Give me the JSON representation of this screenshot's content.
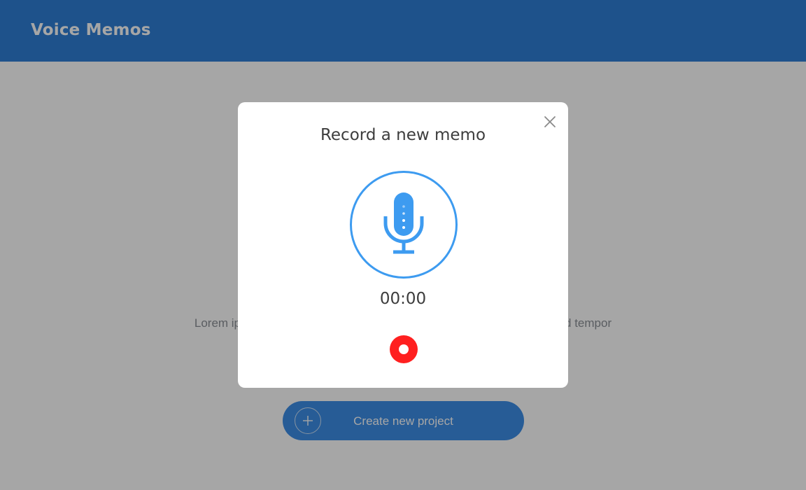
{
  "header": {
    "title": "Voice Memos"
  },
  "main": {
    "description": "Lorem ipsum dolor sit amet, consectetur adipiscing elit, sed do eiusmod tempor",
    "create_button_label": "Create new project",
    "create_button_icon": "plus-icon"
  },
  "modal": {
    "title": "Record a new memo",
    "timer": "00:00",
    "close_icon": "close-icon",
    "mic_icon": "microphone-icon",
    "record_icon": "record-icon"
  },
  "colors": {
    "header": "#2f7fd6",
    "accent": "#3d9bf0",
    "record": "#ff2020"
  }
}
